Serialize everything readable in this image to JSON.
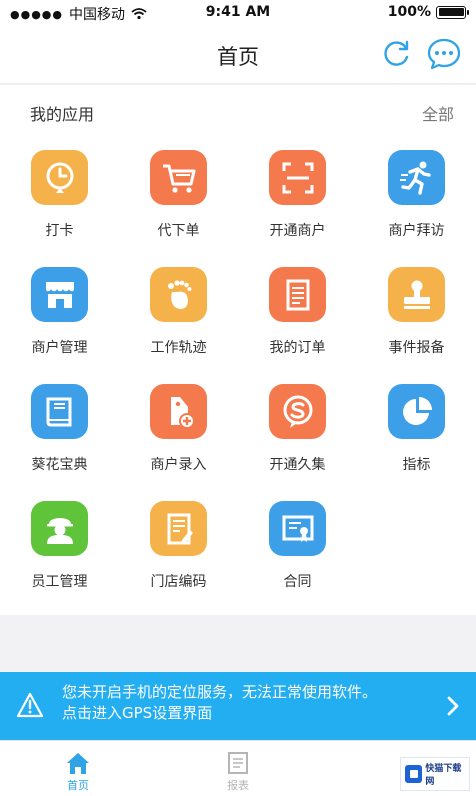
{
  "status": {
    "carrier": "中国移动",
    "time": "9:41 AM",
    "battery": "100%"
  },
  "nav": {
    "title": "首页",
    "refresh_icon": "refresh-icon",
    "chat_icon": "chat-icon"
  },
  "apps_section": {
    "title": "我的应用",
    "all_label": "全部",
    "items": [
      {
        "label": "打卡",
        "icon": "clock-icon",
        "color": "#f6b24a"
      },
      {
        "label": "代下单",
        "icon": "cart-icon",
        "color": "#f47a4e"
      },
      {
        "label": "开通商户",
        "icon": "scan-icon",
        "color": "#f47a4e"
      },
      {
        "label": "商户拜访",
        "icon": "running-man-icon",
        "color": "#3d9fe8"
      },
      {
        "label": "商户管理",
        "icon": "store-icon",
        "color": "#3d9fe8"
      },
      {
        "label": "工作轨迹",
        "icon": "footprint-icon",
        "color": "#f6b24a"
      },
      {
        "label": "我的订单",
        "icon": "document-icon",
        "color": "#f47a4e"
      },
      {
        "label": "事件报备",
        "icon": "stamp-icon",
        "color": "#f6b24a"
      },
      {
        "label": "葵花宝典",
        "icon": "book-icon",
        "color": "#3d9fe8"
      },
      {
        "label": "商户录入",
        "icon": "tag-add-icon",
        "color": "#f47a4e"
      },
      {
        "label": "开通久集",
        "icon": "s-bubble-icon",
        "color": "#f47a4e"
      },
      {
        "label": "指标",
        "icon": "pie-chart-icon",
        "color": "#3d9fe8"
      },
      {
        "label": "员工管理",
        "icon": "worker-icon",
        "color": "#5fc43a"
      },
      {
        "label": "门店编码",
        "icon": "notepad-icon",
        "color": "#f6b24a"
      },
      {
        "label": "合同",
        "icon": "certificate-icon",
        "color": "#3d9fe8"
      }
    ]
  },
  "banner": {
    "line1": "您未开启手机的定位服务，无法正常使用软件。",
    "line2": "点击进入GPS设置界面",
    "color": "#23aef2"
  },
  "tabs": [
    {
      "label": "首页",
      "icon": "home-icon",
      "active": true
    },
    {
      "label": "报表",
      "icon": "report-icon",
      "active": false
    },
    {
      "label": "",
      "icon": "message-icon",
      "active": false
    }
  ],
  "watermark": {
    "text": "快猫下载网"
  },
  "colors": {
    "accent": "#2fa3e6",
    "orange": "#f47a4e",
    "yellow": "#f6b24a",
    "blue": "#3d9fe8",
    "green": "#5fc43a"
  }
}
